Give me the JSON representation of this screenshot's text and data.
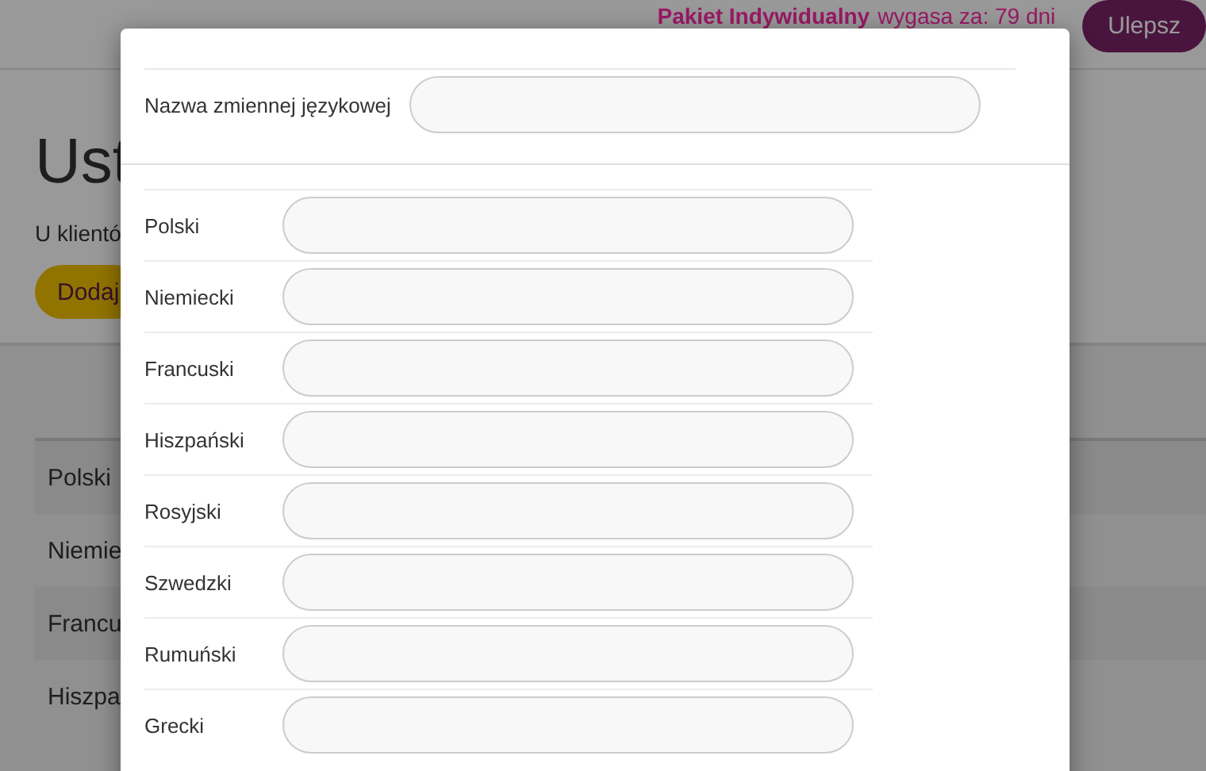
{
  "topbar": {
    "plan": "Pakiet Indywidualny",
    "expiry": "wygasa za: 79 dni",
    "upgrade_button": "Ulepsz"
  },
  "page": {
    "title": "Ust",
    "subtitle": "U klientó",
    "add_button": "Dodaj",
    "rows": [
      "Polski",
      "Niemie",
      "Francu",
      "Hiszpa"
    ]
  },
  "dialog": {
    "name_label": "Nazwa zmiennej językowej",
    "languages": [
      "Polski",
      "Niemiecki",
      "Francuski",
      "Hiszpański",
      "Rosyjski",
      "Szwedzki",
      "Rumuński",
      "Grecki"
    ]
  }
}
